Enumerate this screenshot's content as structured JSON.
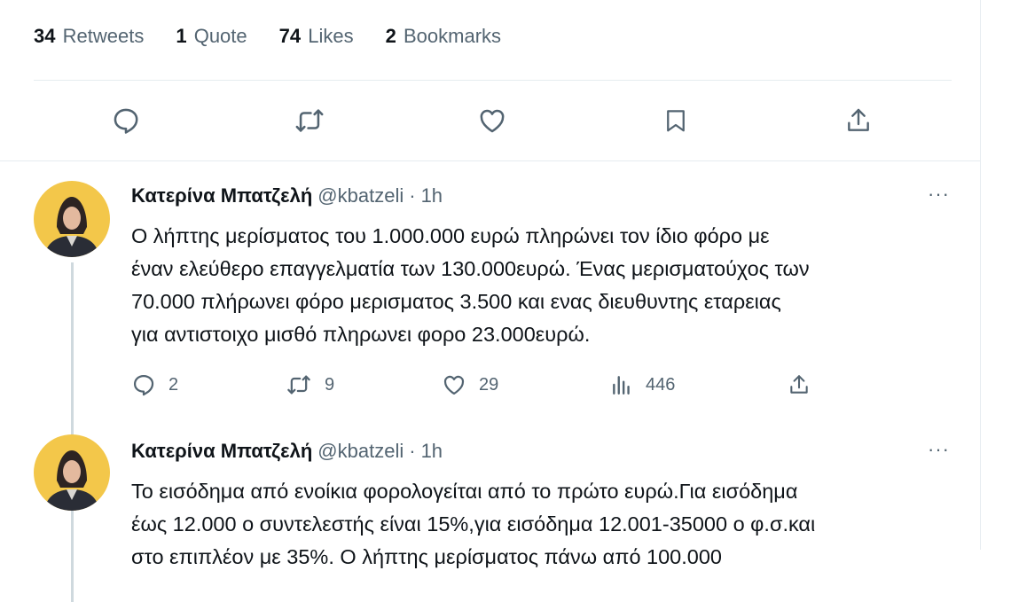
{
  "stats": [
    {
      "count": "34",
      "label": "Retweets"
    },
    {
      "count": "1",
      "label": "Quote"
    },
    {
      "count": "74",
      "label": "Likes"
    },
    {
      "count": "2",
      "label": "Bookmarks"
    }
  ],
  "tweets": [
    {
      "name": "Κατερίνα Μπατζελή",
      "handle": "@kbatzeli",
      "dot": "·",
      "time": "1h",
      "more": "···",
      "lines": [
        "Ο λήπτης μερίσματος του 1.000.000 ευρώ πληρώνει τον ίδιο φόρο με",
        "έναν ελεύθερο επαγγελματία των 130.000ευρώ. Ένας μερισματούχος των",
        "70.000 πλήρωνει φόρο μερισματος 3.500 και ενας διευθυντης εταρειας",
        "για αντιστοιχο μισθό πληρωνει φορο 23.000ευρώ."
      ],
      "replies": "2",
      "retweets": "9",
      "likes": "29",
      "views": "446"
    },
    {
      "name": "Κατερίνα Μπατζελή",
      "handle": "@kbatzeli",
      "dot": "·",
      "time": "1h",
      "more": "···",
      "lines": [
        "Το εισόδημα από ενοίκια φορολογείται από το πρώτο ευρώ.Για εισόδημα",
        "έως 12.000 ο συντελεστής είναι 15%,για εισόδημα 12.001-35000 ο φ.σ.και",
        "στο επιπλέον με 35%. Ο λήπτης μερίσματος πάνω από 100.000"
      ]
    }
  ],
  "icons": {
    "reply": "reply-icon",
    "retweet": "retweet-icon",
    "like": "heart-icon",
    "bookmark": "bookmark-icon",
    "share": "share-icon",
    "views": "views-icon"
  },
  "colors": {
    "text": "#0f1419",
    "muted": "#536471",
    "divider": "#e6ecf0",
    "thread": "#cfd9de",
    "avatar_bg": "#f3c74a"
  }
}
